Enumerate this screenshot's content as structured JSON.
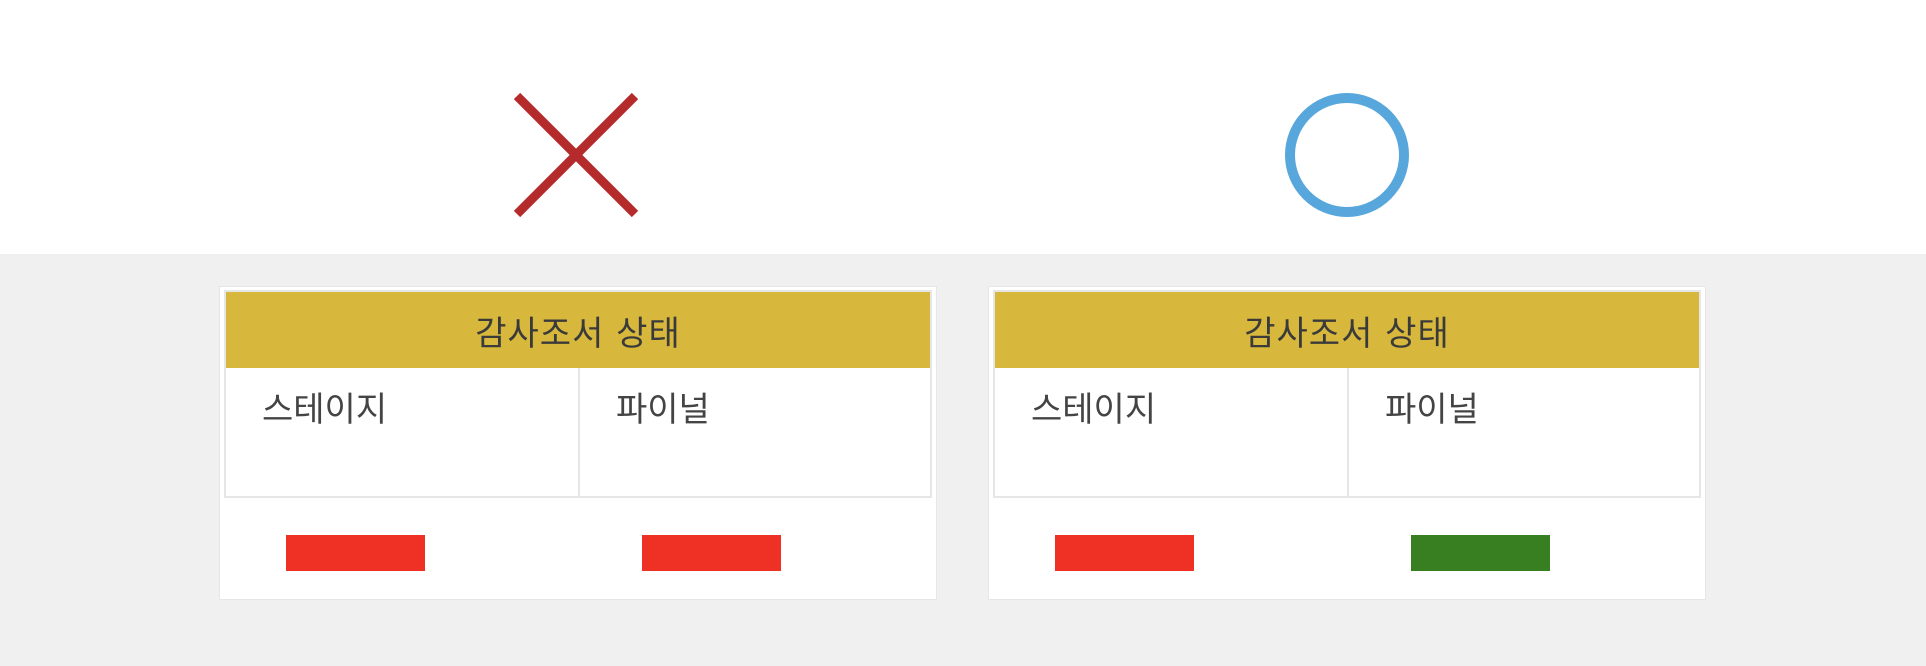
{
  "comparison": {
    "wrong": {
      "mark_icon": "cross-icon",
      "mark_color": "#b52a2a",
      "card": {
        "title": "감사조서 상태",
        "columns": [
          "스테이지",
          "파이널"
        ],
        "status_colors": [
          "#ee3124",
          "#ee3124"
        ]
      }
    },
    "right": {
      "mark_icon": "circle-icon",
      "mark_color": "#57a7dc",
      "card": {
        "title": "감사조서 상태",
        "columns": [
          "스테이지",
          "파이널"
        ],
        "status_colors": [
          "#ee3124",
          "#387f21"
        ]
      }
    }
  },
  "colors": {
    "header_background": "#d8b83c",
    "bottom_background": "#f0f0f0"
  }
}
